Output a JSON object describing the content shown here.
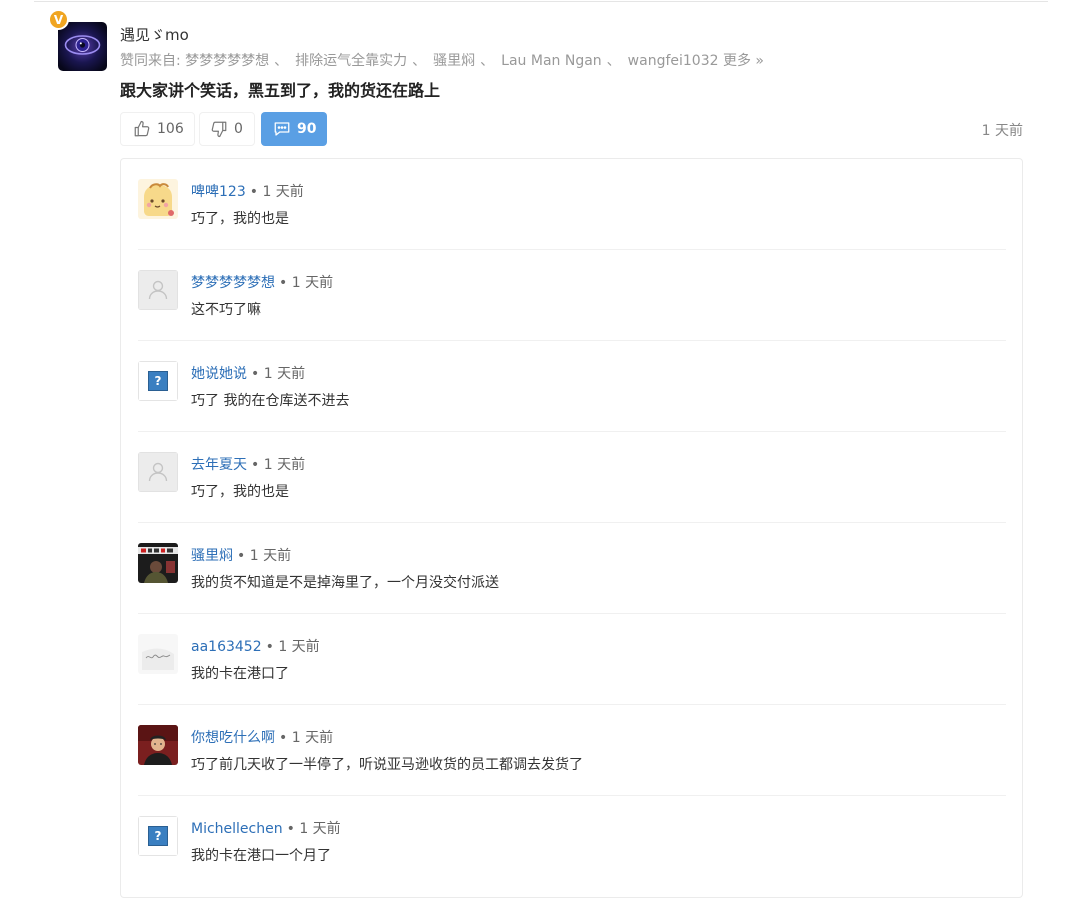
{
  "post": {
    "author": "遇见ゞmo",
    "vip_badge": "V",
    "likers_prefix": "赞同来自: ",
    "likers": [
      "梦梦梦梦梦想",
      "排除运气全靠实力",
      "骚里焖",
      "Lau Man Ngan",
      "wangfei1032"
    ],
    "likers_sep": "、",
    "more_label": "更多 »",
    "text": "跟大家讲个笑话，黑五到了，我的货还在路上",
    "upvotes": "106",
    "downvotes": "0",
    "comment_count": "90",
    "time": "1 天前"
  },
  "comments": [
    {
      "user": "啤啤123",
      "meta": "• 1 天前",
      "text": "巧了，我的也是",
      "avatar": "cartoon-avatar"
    },
    {
      "user": "梦梦梦梦梦想",
      "meta": "• 1 天前",
      "text": "这不巧了嘛",
      "avatar": "default-user-avatar"
    },
    {
      "user": "她说她说",
      "meta": "• 1 天前",
      "text": "巧了 我的在仓库送不进去",
      "avatar": "broken-image-avatar"
    },
    {
      "user": "去年夏天",
      "meta": "• 1 天前",
      "text": "巧了，我的也是",
      "avatar": "default-user-avatar"
    },
    {
      "user": "骚里焖",
      "meta": "• 1 天前",
      "text": "我的货不知道是不是掉海里了，一个月没交付派送",
      "avatar": "photo-avatar"
    },
    {
      "user": "aa163452",
      "meta": "• 1 天前",
      "text": "我的卡在港口了",
      "avatar": "signature-avatar"
    },
    {
      "user": "你想吃什么啊",
      "meta": "• 1 天前",
      "text": "巧了前几天收了一半停了，听说亚马逊收货的员工都调去发货了",
      "avatar": "portrait-avatar"
    },
    {
      "user": "Michellechen",
      "meta": "• 1 天前",
      "text": "我的卡在港口一个月了",
      "avatar": "broken-image-avatar"
    }
  ],
  "colors": {
    "link": "#2d6fb7",
    "comment_button": "#5a9fe4",
    "vip_badge": "#f0a521"
  }
}
